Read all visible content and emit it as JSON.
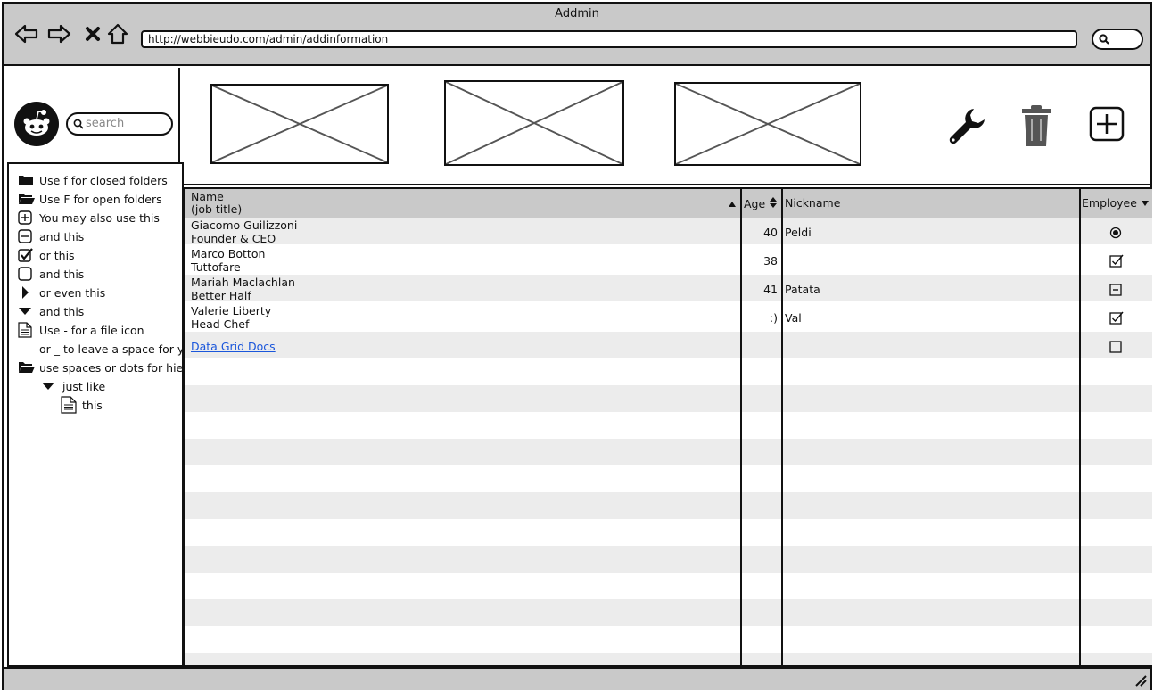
{
  "window": {
    "title": "Addmin"
  },
  "browser": {
    "url": "http://webbieudo.com/admin/addinformation",
    "back_icon": "arrow-left-icon",
    "forward_icon": "arrow-right-icon",
    "stop_icon": "close-icon",
    "home_icon": "home-icon"
  },
  "header": {
    "logo_icon": "reddit-logo-icon",
    "search_placeholder": "search",
    "tools": [
      "wrench-icon",
      "trash-icon",
      "plus-square-icon"
    ]
  },
  "tree": {
    "items": [
      {
        "icon": "folder-closed-icon",
        "label": "Use f for closed folders"
      },
      {
        "icon": "folder-open-icon",
        "label": "Use F for open folders"
      },
      {
        "icon": "plus-square-icon",
        "label": "You may also use this"
      },
      {
        "icon": "minus-square-icon",
        "label": "and this"
      },
      {
        "icon": "checkbox-checked-icon",
        "label": "or this"
      },
      {
        "icon": "checkbox-empty-icon",
        "label": "and this"
      },
      {
        "icon": "triangle-right-icon",
        "label": "or even this"
      },
      {
        "icon": "triangle-down-icon",
        "label": "and this"
      },
      {
        "icon": "file-icon",
        "label": "Use - for a file icon"
      },
      {
        "icon": "",
        "label": "or _ to leave a space for your"
      },
      {
        "icon": "folder-open-icon",
        "label": "use spaces or dots for hierarchy"
      },
      {
        "icon": "triangle-down-icon",
        "label": "just like"
      },
      {
        "icon": "file-icon",
        "label": "this"
      }
    ]
  },
  "grid": {
    "columns": {
      "name": "Name",
      "name_sub": "(job title)",
      "age": "Age",
      "nickname": "Nickname",
      "employee": "Employee"
    },
    "rows": [
      {
        "name": "Giacomo Guilizzoni",
        "title": "Founder & CEO",
        "age": "40",
        "nickname": "Peldi",
        "employee": "radio-selected"
      },
      {
        "name": "Marco Botton",
        "title": "Tuttofare",
        "age": "38",
        "nickname": "",
        "employee": "checked"
      },
      {
        "name": "Mariah Maclachlan",
        "title": "Better Half",
        "age": "41",
        "nickname": "Patata",
        "employee": "indeterminate"
      },
      {
        "name": "Valerie Liberty",
        "title": "Head Chef",
        "age": ":)",
        "nickname": "Val",
        "employee": "checked"
      }
    ],
    "link_row": {
      "label": "Data Grid Docs",
      "employee": "unchecked"
    }
  }
}
